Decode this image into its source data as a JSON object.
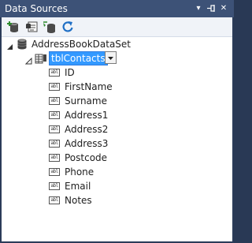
{
  "panel": {
    "title": "Data Sources",
    "title_buttons": [
      "▾",
      "⊣",
      "✕"
    ]
  },
  "toolbar": {
    "buttons": [
      "add-data-source",
      "edit-dataset-with-designer",
      "configure-dataset-with-wizard",
      "refresh"
    ]
  },
  "tree": {
    "dataset": {
      "label": "AddressBookDataSet",
      "expander": "▲"
    },
    "table": {
      "label": "tblContacts",
      "expander": "◿",
      "dropdown": "▾"
    },
    "field_icon_text": "abl",
    "fields": [
      "ID",
      "FirstName",
      "Surname",
      "Address1",
      "Address2",
      "Address3",
      "Postcode",
      "Phone",
      "Email",
      "Notes"
    ]
  }
}
